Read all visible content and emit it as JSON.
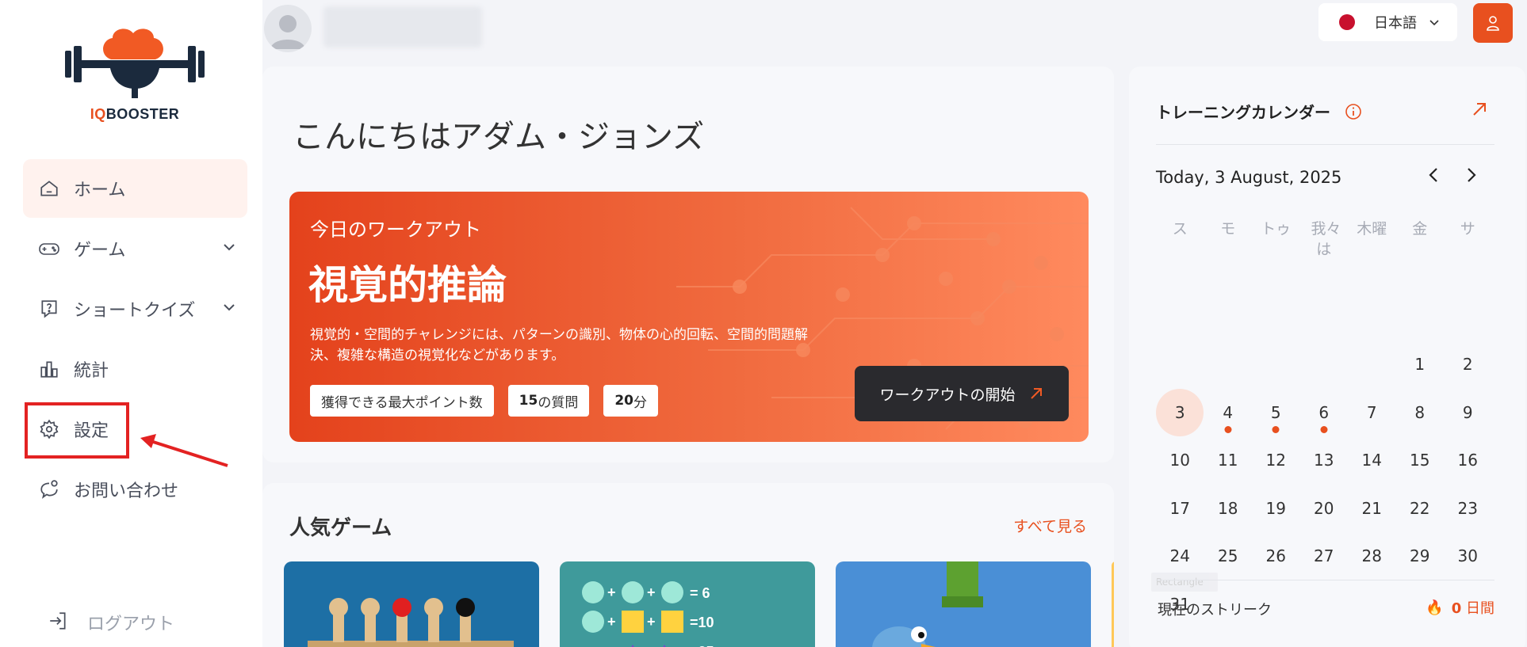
{
  "brand": {
    "logo_prefix": "IQ",
    "logo_suffix": "BOOSTER"
  },
  "sidebar": {
    "items": [
      {
        "label": "ホーム",
        "icon": "home-icon",
        "active": true
      },
      {
        "label": "ゲーム",
        "icon": "gamepad-icon",
        "expandable": true
      },
      {
        "label": "ショートクイズ",
        "icon": "quiz-icon",
        "expandable": true
      },
      {
        "label": "統計",
        "icon": "chart-icon"
      },
      {
        "label": "設定",
        "icon": "gear-icon"
      },
      {
        "label": "お問い合わせ",
        "icon": "contact-icon"
      }
    ],
    "logout_label": "ログアウト"
  },
  "header": {
    "language": "日本語"
  },
  "greeting": "こんにちはアダム・ジョンズ",
  "workout": {
    "subtitle": "今日のワークアウト",
    "title": "視覚的推論",
    "description": "視覚的・空間的チャレンジには、パターンの識別、物体の心的回転、空間的問題解決、複雑な構造の視覚化などがあります。",
    "chip_points": "獲得できる最大ポイント数",
    "chip_questions_num": "15",
    "chip_questions_unit": "の質問",
    "chip_time_num": "20",
    "chip_time_unit": "分",
    "start_label": "ワークアウトの開始"
  },
  "games": {
    "title": "人気ゲーム",
    "see_all": "すべて見る"
  },
  "calendar": {
    "title": "トレーニングカレンダー",
    "date_label": "Today, 3 August, 2025",
    "weekdays": [
      "ス",
      "モ",
      "トゥ",
      "我々は",
      "木曜",
      "金",
      "サ"
    ],
    "weeks": [
      [
        "",
        "",
        "",
        "",
        "",
        "1",
        "2"
      ],
      [
        "3",
        "4",
        "5",
        "6",
        "7",
        "8",
        "9"
      ],
      [
        "10",
        "11",
        "12",
        "13",
        "14",
        "15",
        "16"
      ],
      [
        "17",
        "18",
        "19",
        "20",
        "21",
        "22",
        "23"
      ],
      [
        "24",
        "25",
        "26",
        "27",
        "28",
        "29",
        "30"
      ],
      [
        "31",
        "",
        "",
        "",
        "",
        "",
        ""
      ]
    ],
    "today": "3",
    "marked_days": [
      "4",
      "5",
      "6"
    ],
    "streak_label": "現在のストリーク",
    "streak_value": "0",
    "streak_unit": "日間",
    "overlay_label": "Rectangle"
  },
  "colors": {
    "accent": "#e8501f",
    "highlight": "#e32222"
  }
}
